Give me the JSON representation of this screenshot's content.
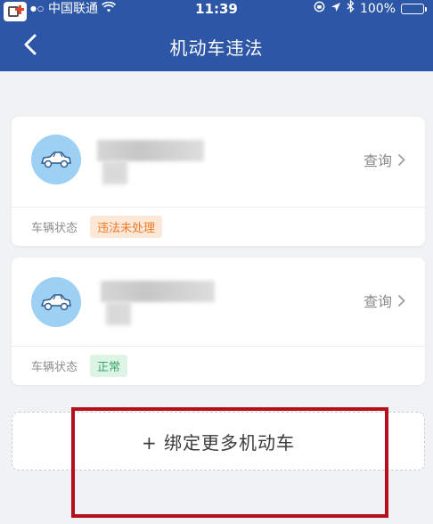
{
  "status_bar": {
    "carrier": "中国联通",
    "time": "11:39",
    "battery": "100%",
    "battery_level": 1.0
  },
  "header": {
    "title": "机动车违法",
    "back_icon": "chevron-left-icon"
  },
  "vehicles": [
    {
      "status_label": "车辆状态",
      "status_value": "违法未处理",
      "query_label": "查询",
      "status_color": "#f07c28"
    },
    {
      "status_label": "车辆状态",
      "status_value": "正常",
      "query_label": "查询",
      "status_color": "#3aa56b"
    }
  ],
  "add_button": {
    "label": "+ 绑定更多机动车"
  },
  "colors": {
    "header_bg": "#2d57a6",
    "highlight": "#b30f1c",
    "avatar_bg": "#9ed0f4"
  }
}
